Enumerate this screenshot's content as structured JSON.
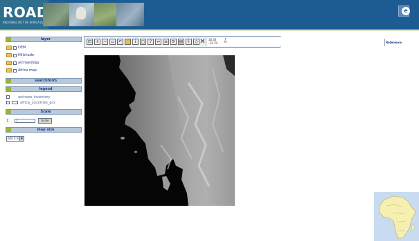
{
  "header": {
    "title": "ROAD",
    "subtitle": "REGIONAL OUT OF AFRICA DATABASE",
    "lang_icon_name": "globe-icon",
    "colors": {
      "header_bg": "#1d5c93",
      "accent": "#86a631"
    }
  },
  "sidebar": {
    "layer_header": "layer",
    "layers": [
      {
        "label": "DEM",
        "icon": "folder-icon",
        "checked": false
      },
      {
        "label": "Hillshade",
        "icon": "folder-icon",
        "checked": false
      },
      {
        "label": "archaeology",
        "icon": "folder-icon",
        "checked": false
      },
      {
        "label": "Africa map",
        "icon": "folder-icon",
        "checked": false
      }
    ],
    "searchform_header": "searchform",
    "legend_header": "legend",
    "legend_items": [
      {
        "label": "archaeo_inventory",
        "checked": false
      },
      {
        "label": "africa_countries_gcs",
        "checked": false
      }
    ],
    "scale_header": "Scale",
    "scale_prefix": "1:",
    "scale_value": "1",
    "scale_button": "Scale",
    "mapsize_header": "map size",
    "mapsize_value": "600 X 600"
  },
  "toolbar": {
    "tools": [
      "zoom-full-icon",
      "zoom-in-icon",
      "zoom-out-icon",
      "zoom-box-icon",
      "zoom-back-icon",
      "pan-hand-icon",
      "identify-icon",
      "select-icon",
      "query-icon",
      "measure-icon",
      "layer-icon",
      "refresh-icon",
      "print-icon",
      "export-icon",
      "help-icon",
      "clear-icon"
    ],
    "coord_lon": "18.36",
    "coord_lat": "-33.79",
    "north_label": "N",
    "reference_label": "Reference"
  },
  "map": {
    "description_color_land": "#9a9a9a",
    "description_color_sea": "#050505"
  }
}
